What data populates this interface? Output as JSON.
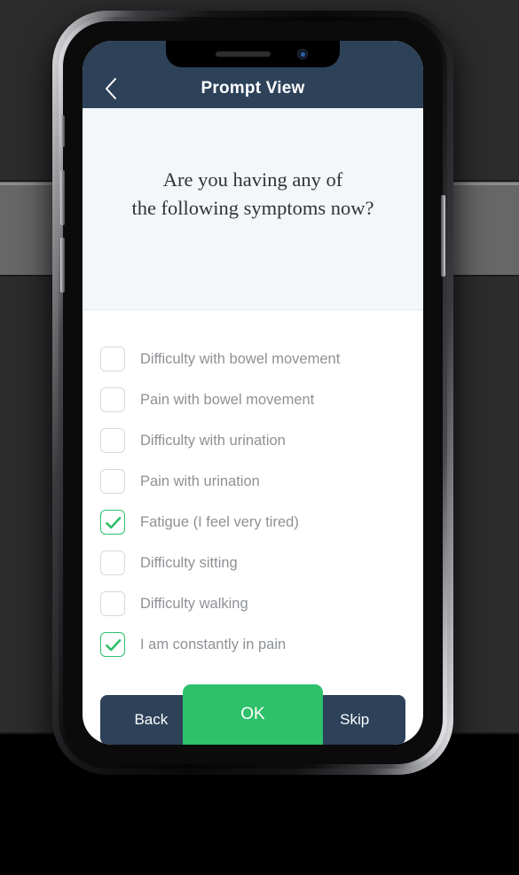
{
  "appbar": {
    "title": "Prompt View",
    "back_icon": "chevron-left-icon"
  },
  "question": {
    "line1": "Are you having any of",
    "line2": "the following symptoms now?"
  },
  "symptoms": [
    {
      "label": "Difficulty with bowel movement",
      "checked": false
    },
    {
      "label": "Pain with bowel movement",
      "checked": false
    },
    {
      "label": "Difficulty with urination",
      "checked": false
    },
    {
      "label": "Pain with urination",
      "checked": false
    },
    {
      "label": "Fatigue (I feel very tired)",
      "checked": true
    },
    {
      "label": "Difficulty sitting",
      "checked": false
    },
    {
      "label": "Difficulty walking",
      "checked": false
    },
    {
      "label": "I am constantly in pain",
      "checked": true
    }
  ],
  "footer": {
    "back_label": "Back",
    "ok_label": "OK",
    "skip_label": "Skip"
  },
  "colors": {
    "appbar": "#2d4159",
    "accent_green": "#2ec06a",
    "panel": "#f4f7fa",
    "label_gray": "#8e9195",
    "checkbox_border": "#d6dade"
  },
  "device": {
    "notch_speaker": "speaker-grille",
    "notch_camera": "front-camera"
  }
}
